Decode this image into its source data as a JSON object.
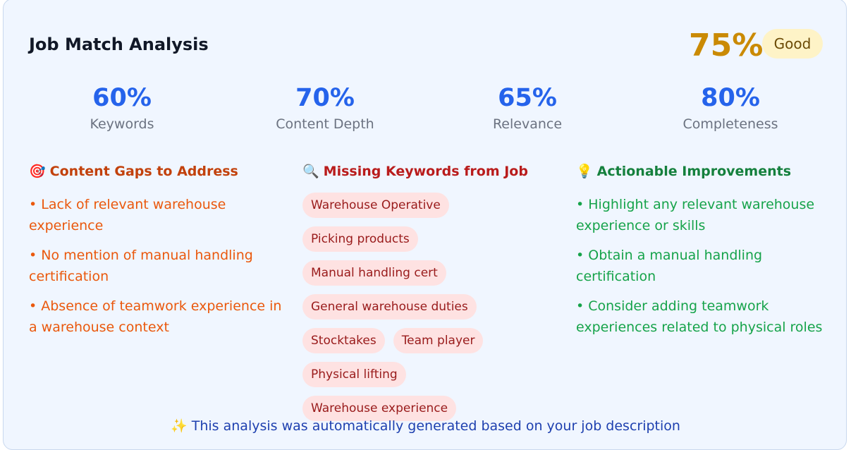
{
  "header": {
    "title": "Job Match Analysis",
    "overall_score": "75%",
    "rating_badge": "Good"
  },
  "metrics": [
    {
      "value": "60%",
      "label": "Keywords"
    },
    {
      "value": "70%",
      "label": "Content Depth"
    },
    {
      "value": "65%",
      "label": "Relevance"
    },
    {
      "value": "80%",
      "label": "Completeness"
    }
  ],
  "gaps": {
    "icon": "🎯",
    "icon_name": "target-icon",
    "heading": "Content Gaps to Address",
    "items": [
      "• Lack of relevant warehouse experience",
      "• No mention of manual handling certification",
      "• Absence of teamwork experience in a warehouse context"
    ]
  },
  "missing": {
    "icon": "🔍",
    "icon_name": "magnifier-icon",
    "heading": "Missing Keywords from Job",
    "tags": [
      "Warehouse Operative",
      "Picking products",
      "Manual handling cert",
      "General warehouse duties",
      "Stocktakes",
      "Team player",
      "Physical lifting",
      "Warehouse experience"
    ]
  },
  "improvements": {
    "icon": "💡",
    "icon_name": "lightbulb-icon",
    "heading": "Actionable Improvements",
    "items": [
      "• Highlight any relevant warehouse experience or skills",
      "• Obtain a manual handling certification",
      "• Consider adding teamwork experiences related to physical roles"
    ]
  },
  "footer": {
    "icon": "✨",
    "icon_name": "sparkles-icon",
    "text": "This analysis was automatically generated based on your job description"
  },
  "colors": {
    "score": "#ca8a04",
    "metric": "#2563eb",
    "gaps": "#ea580c",
    "missing": "#b91c1c",
    "improvements": "#16a34a"
  }
}
